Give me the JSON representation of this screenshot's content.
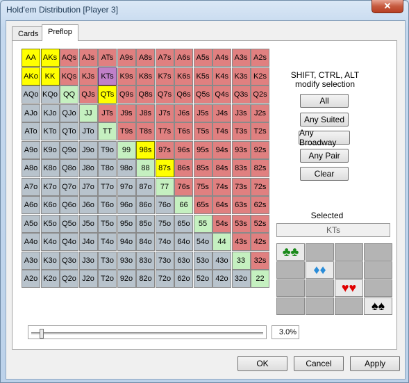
{
  "window": {
    "title": "Hold'em Distribution [Player 3]",
    "close_glyph": "✕"
  },
  "tabs": [
    {
      "label": "Cards"
    },
    {
      "label": "Preflop"
    }
  ],
  "grid": {
    "ranks": [
      "A",
      "K",
      "Q",
      "J",
      "T",
      "9",
      "8",
      "7",
      "6",
      "5",
      "4",
      "3",
      "2"
    ],
    "selected": [
      "AA",
      "AKs",
      "AKo",
      "KK",
      "QTs",
      "98s",
      "87s"
    ],
    "current": "KTs"
  },
  "modifier_hint": {
    "line1": "SHIFT, CTRL, ALT",
    "line2": "modify selection"
  },
  "buttons": {
    "all": "All",
    "any_suited": "Any Suited",
    "any_broadway": "Any Broadway",
    "any_pair": "Any Pair",
    "clear": "Clear"
  },
  "selected_panel": {
    "label": "Selected",
    "value": "KTs"
  },
  "suits": {
    "clubs": "♣♣",
    "diamonds": "♦♦",
    "hearts": "♥♥",
    "spades": "♠♠",
    "colors": {
      "clubs": "#1a8a1a",
      "diamonds": "#2a8cd8",
      "hearts": "#e00000",
      "spades": "#000000"
    }
  },
  "range": {
    "fraction": 0.03,
    "percent_text": "3.0%"
  },
  "footer": {
    "ok": "OK",
    "cancel": "Cancel",
    "apply": "Apply"
  }
}
